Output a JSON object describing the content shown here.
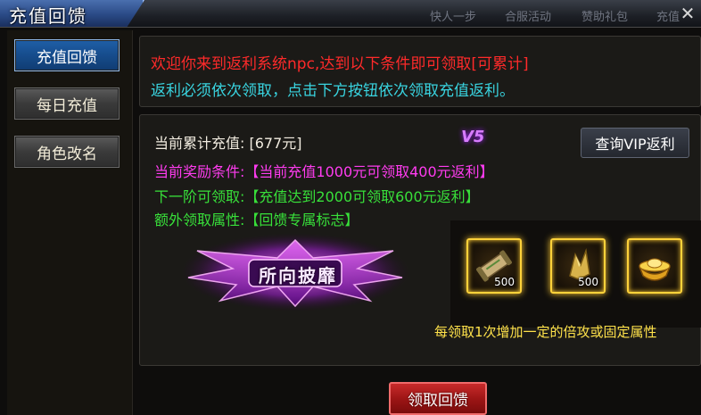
{
  "window": {
    "title": "充值回馈",
    "background_tabs": [
      "快人一步",
      "合服活动",
      "赞助礼包",
      "充值"
    ],
    "close_glyph": "✕"
  },
  "sidebar": {
    "items": [
      {
        "label": "充值回馈",
        "active": true
      },
      {
        "label": "每日充值",
        "active": false
      },
      {
        "label": "角色改名",
        "active": false
      }
    ]
  },
  "notice": {
    "line1": "欢迎你来到返利系统npc,达到以下条件即可领取[可累计]",
    "line2": "返利必须依次领取，点击下方按钮依次领取充值返利。"
  },
  "info": {
    "total_label": "当前累计充值:",
    "total_value": "[677元]",
    "condition_label": "当前奖励条件:",
    "condition_value": "【当前充值1000元可领取400元返利】",
    "next_label": "下一阶可领取:",
    "next_value": "【充值达到2000可领取600元返利】",
    "extra_label": "额外领取属性:",
    "extra_value": "【回馈专属标志】"
  },
  "vip": {
    "badge": "V5",
    "button_label": "查询VIP返利"
  },
  "emblem": {
    "text": "所向披靡"
  },
  "rewards": {
    "items": [
      {
        "icon": "scroll-icon",
        "count": "500"
      },
      {
        "icon": "gold-ore-icon",
        "count": "500"
      },
      {
        "icon": "gold-ingot-icon",
        "count": ""
      }
    ],
    "note": "每领取1次增加一定的倍攻或固定属性"
  },
  "claim_button": "领取回馈",
  "colors": {
    "notice_red": "#ff2a2a",
    "notice_cyan": "#39d4e0",
    "condition_magenta": "#ff3cf0",
    "next_green": "#38e03a",
    "reward_note_yellow": "#ffe24a",
    "claim_button_red": "#b01c1c"
  }
}
